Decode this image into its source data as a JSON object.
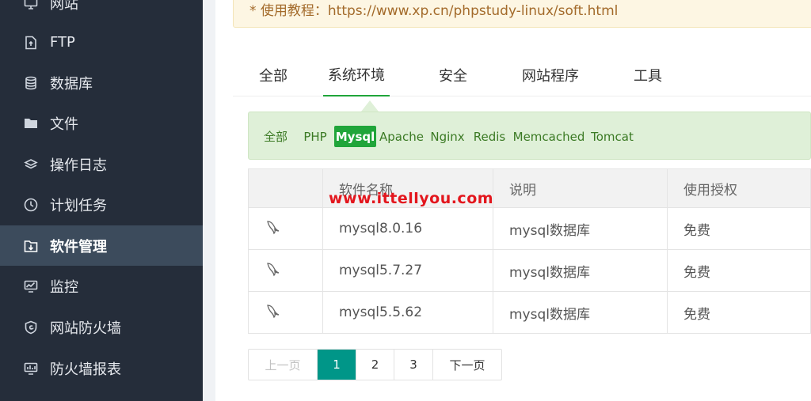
{
  "sidebar": {
    "items": [
      {
        "label": "网站",
        "icon": "monitor-icon",
        "active": false
      },
      {
        "label": "FTP",
        "icon": "ftp-file-icon",
        "active": false
      },
      {
        "label": "数据库",
        "icon": "database-icon",
        "active": false
      },
      {
        "label": "文件",
        "icon": "folder-icon",
        "active": false
      },
      {
        "label": "操作日志",
        "icon": "layers-icon",
        "active": false
      },
      {
        "label": "计划任务",
        "icon": "clock-icon",
        "active": false
      },
      {
        "label": "软件管理",
        "icon": "download-folder-icon",
        "active": true
      },
      {
        "label": "监控",
        "icon": "chart-monitor-icon",
        "active": false
      },
      {
        "label": "网站防火墙",
        "icon": "shield-icon",
        "active": false
      },
      {
        "label": "防火墙报表",
        "icon": "report-icon",
        "active": false
      }
    ]
  },
  "notice": {
    "text": "* 使用教程：https://www.xp.cn/phpstudy-linux/soft.html"
  },
  "tabs": [
    {
      "label": "全部"
    },
    {
      "label": "系统环境",
      "active": true
    },
    {
      "label": "安全"
    },
    {
      "label": "网站程序"
    },
    {
      "label": "工具"
    }
  ],
  "filters": [
    {
      "label": "全部"
    },
    {
      "label": "PHP"
    },
    {
      "label": "Mysql",
      "active": true
    },
    {
      "label": "Apache"
    },
    {
      "label": "Nginx"
    },
    {
      "label": "Redis"
    },
    {
      "label": "Memcached"
    },
    {
      "label": "Tomcat"
    }
  ],
  "table": {
    "headers": [
      "",
      "软件名称",
      "说明",
      "使用授权"
    ],
    "rows": [
      {
        "icon": "mysql-dolphin-icon",
        "name": "mysql8.0.16",
        "desc": "mysql数据库",
        "license": "免费"
      },
      {
        "icon": "mysql-dolphin-icon",
        "name": "mysql5.7.27",
        "desc": "mysql数据库",
        "license": "免费"
      },
      {
        "icon": "mysql-dolphin-icon",
        "name": "mysql5.5.62",
        "desc": "mysql数据库",
        "license": "免费"
      }
    ]
  },
  "watermark": "www.ittellyou.com",
  "pagination": {
    "prev": "上一页",
    "pages": [
      "1",
      "2",
      "3"
    ],
    "current": "1",
    "next": "下一页"
  },
  "colors": {
    "sidebar_bg": "#252d3a",
    "sidebar_active": "#3c4b5c",
    "accent_green": "#20a53a",
    "page_current": "#009688"
  }
}
